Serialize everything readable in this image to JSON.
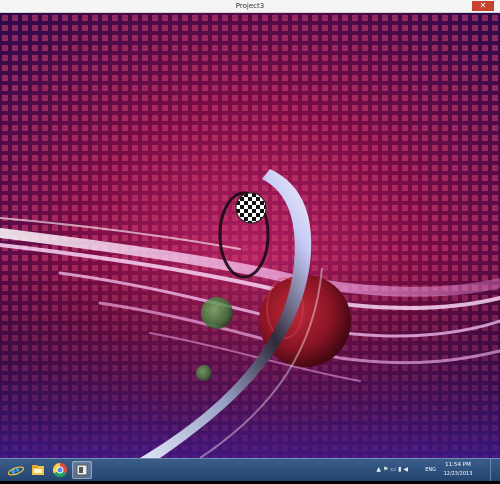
{
  "window": {
    "title": "Project3",
    "close_glyph": "✕"
  },
  "scene": {
    "background_colors": [
      "#2a0a4a",
      "#7a0c45",
      "#b02060"
    ],
    "light_streak_color": "#ffd6ff",
    "checker_ball_colors": [
      "#ffffff",
      "#111111"
    ],
    "red_sphere_color": "#9a1a2a",
    "green_sphere_color": "#3f7a3a"
  },
  "taskbar": {
    "apps": [
      {
        "name": "internet-explorer-icon"
      },
      {
        "name": "file-explorer-icon"
      },
      {
        "name": "chrome-icon"
      },
      {
        "name": "project-window-icon",
        "active": true
      }
    ],
    "tray": {
      "icons": [
        "up-arrow-icon",
        "flag-icon",
        "monitor-icon",
        "network-icon",
        "volume-icon"
      ],
      "language": "ENG",
      "time": "11:54 PM",
      "date": "12/23/2013"
    }
  }
}
